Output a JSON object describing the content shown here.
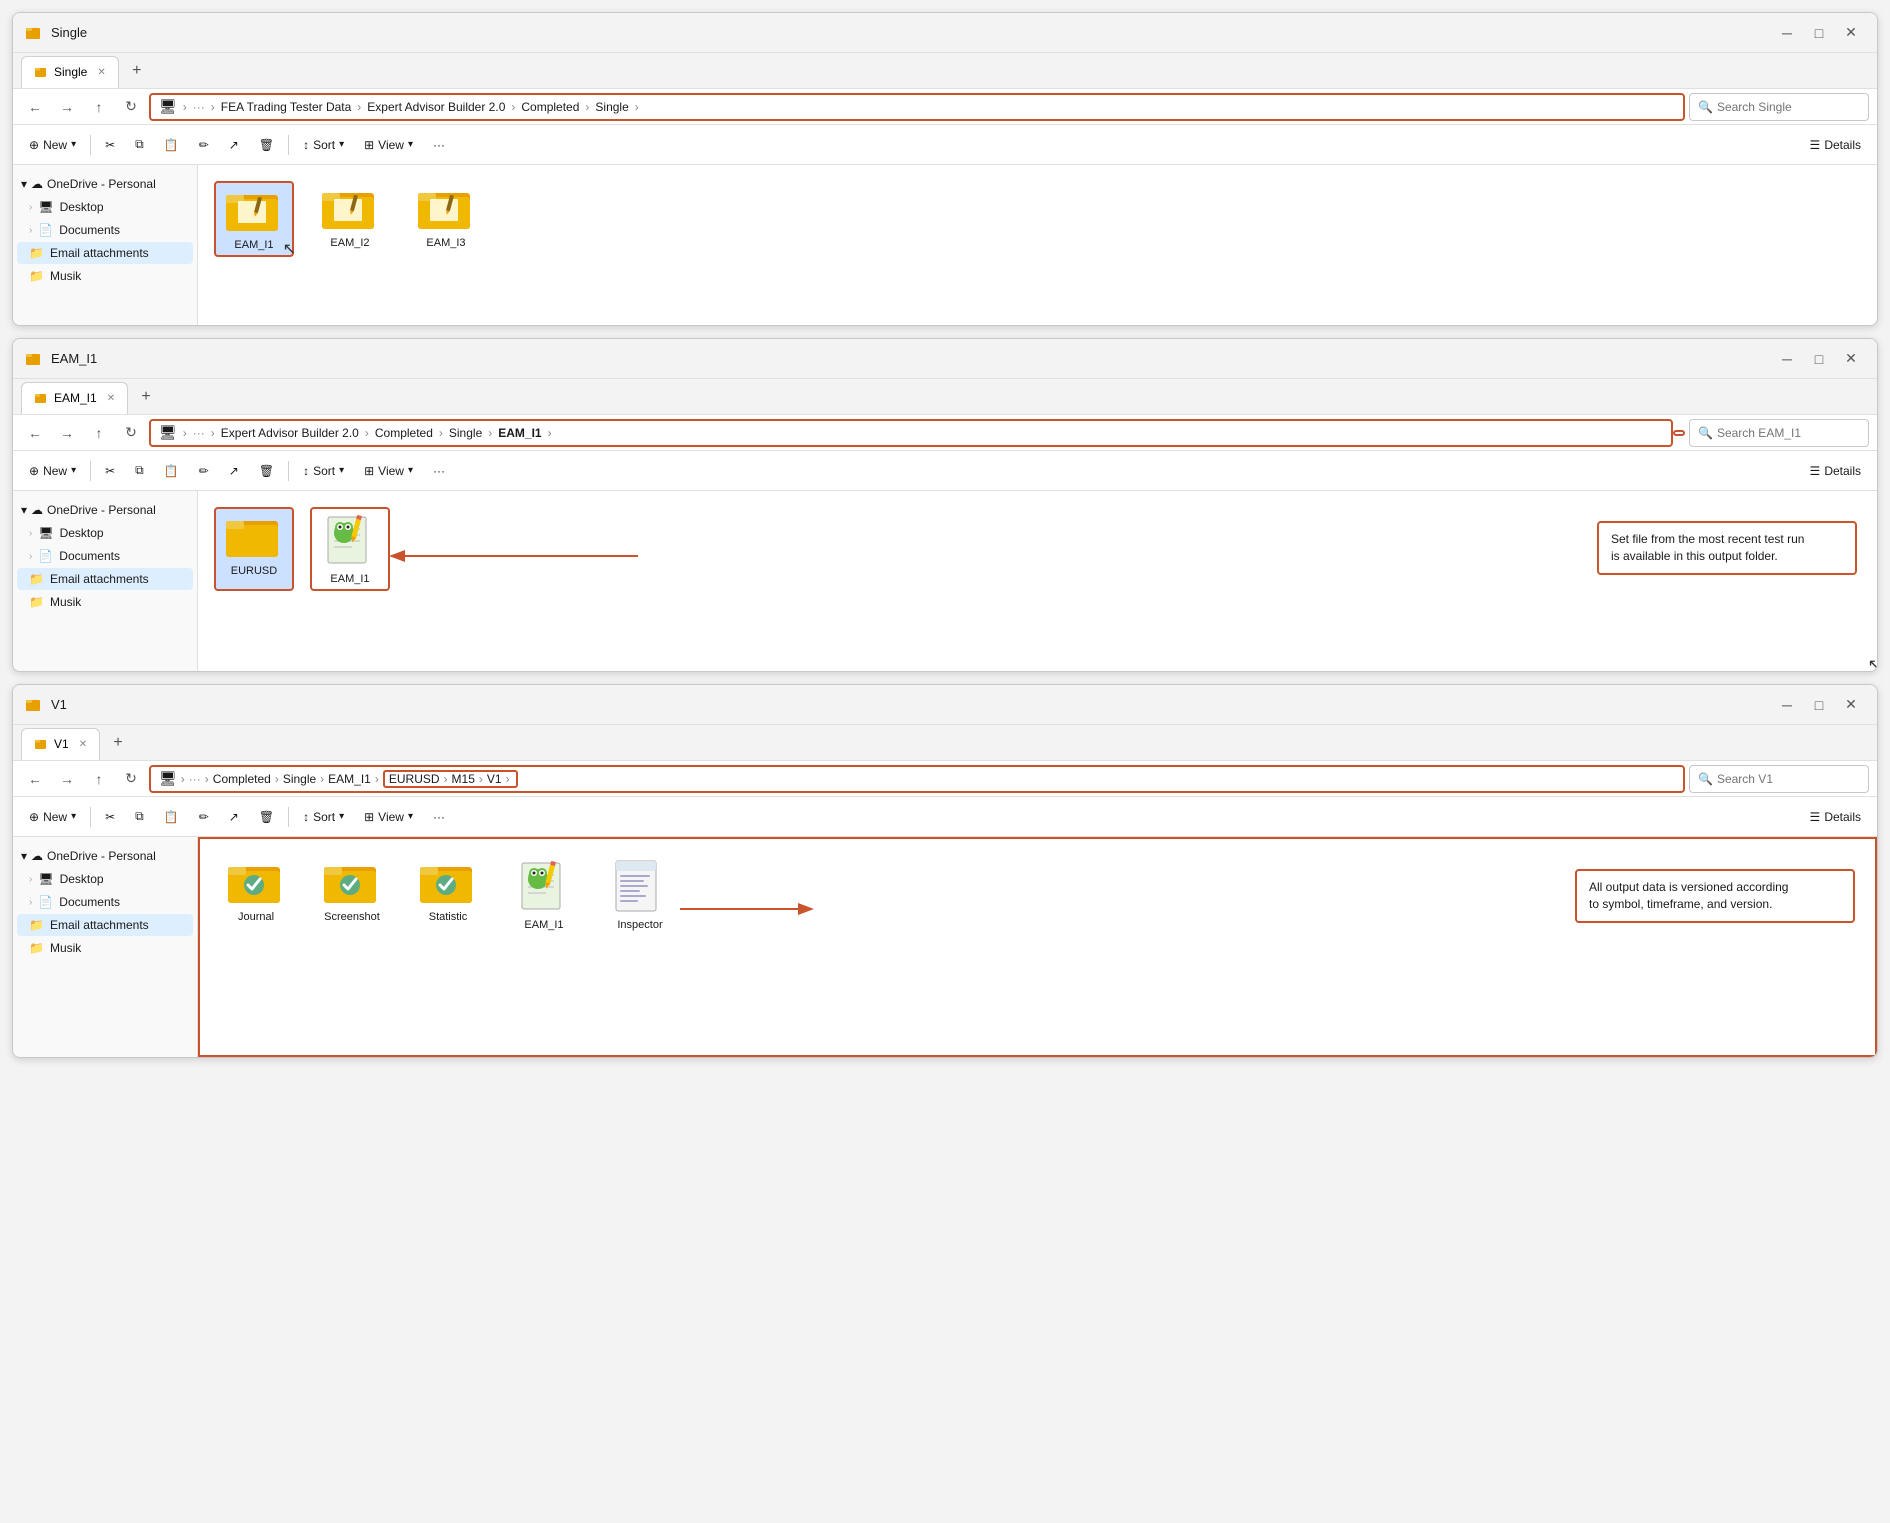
{
  "windows": [
    {
      "id": "w1",
      "title": "Single",
      "tab_label": "Single",
      "breadcrumb": [
        "FEA Trading Tester Data",
        "Expert Advisor Builder 2.0",
        "Completed",
        "Single"
      ],
      "search_placeholder": "Search Single",
      "toolbar": {
        "new_label": "New",
        "sort_label": "Sort",
        "view_label": "View",
        "details_label": "Details"
      },
      "sidebar_items": [
        "Desktop",
        "Documents",
        "Email attachments",
        "Musik"
      ],
      "sidebar_cloud": "OneDrive - Personal",
      "folders": [
        {
          "name": "EAM_I1",
          "selected": true
        },
        {
          "name": "EAM_I2"
        },
        {
          "name": "EAM_I3"
        }
      ]
    },
    {
      "id": "w2",
      "title": "EAM_I1",
      "tab_label": "EAM_I1",
      "breadcrumb": [
        "Expert Advisor Builder 2.0",
        "Completed",
        "Single",
        "EAM_I1"
      ],
      "highlighted_bc": "EAM_I1",
      "search_placeholder": "Search EAM_I1",
      "toolbar": {
        "new_label": "New",
        "sort_label": "Sort",
        "view_label": "View",
        "details_label": "Details"
      },
      "sidebar_items": [
        "Desktop",
        "Documents",
        "Email attachments",
        "Musik"
      ],
      "sidebar_cloud": "OneDrive - Personal",
      "folders": [
        {
          "name": "EURUSD",
          "type": "folder",
          "selected": true
        },
        {
          "name": "EAM_I1",
          "type": "notepad"
        }
      ],
      "annotation": "Set file from the most recent test run\nis available in this output folder."
    },
    {
      "id": "w3",
      "title": "V1",
      "tab_label": "V1",
      "breadcrumb": [
        "Completed",
        "Single",
        "EAM_I1",
        "EURUSD",
        "M15",
        "V1"
      ],
      "highlighted_bc": "EURUSD > M15 > V1",
      "search_placeholder": "Search V1",
      "toolbar": {
        "new_label": "New",
        "sort_label": "Sort",
        "view_label": "View",
        "details_label": "Details"
      },
      "sidebar_items": [
        "Desktop",
        "Documents",
        "Email attachments",
        "Musik"
      ],
      "sidebar_cloud": "OneDrive - Personal",
      "folders": [
        {
          "name": "Journal",
          "type": "folder-check"
        },
        {
          "name": "Screenshot",
          "type": "folder-check"
        },
        {
          "name": "Statistic",
          "type": "folder-check"
        },
        {
          "name": "EAM_I1",
          "type": "notepad"
        },
        {
          "name": "Inspector",
          "type": "inspector"
        }
      ],
      "annotation": "All output data is versioned according\nto symbol, timeframe, and version."
    }
  ],
  "icons": {
    "folder": "📁",
    "close": "✕",
    "minimize": "─",
    "maximize": "□",
    "back": "←",
    "forward": "→",
    "up": "↑",
    "refresh": "↻",
    "search": "🔍",
    "new": "+",
    "cut": "✂",
    "copy": "⧉",
    "paste": "📋",
    "rename": "✏",
    "share": "↗",
    "delete": "🗑",
    "sort": "↕",
    "view": "⊞",
    "more": "···",
    "details": "☰",
    "chevron": "›",
    "expand": "›",
    "cloud": "☁",
    "desktop": "🖥",
    "docs": "📄",
    "email": "📧",
    "music": "🎵"
  }
}
